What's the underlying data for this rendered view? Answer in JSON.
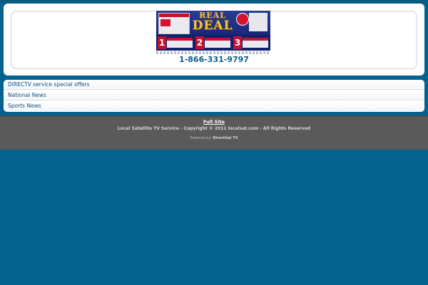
{
  "banner": {
    "headline_top": "REAL",
    "headline_main": "DEAL",
    "offer_numbers": [
      "1",
      "2",
      "3"
    ]
  },
  "header": {
    "phone": "1-866-331-9797"
  },
  "nav": {
    "items": [
      {
        "label": "DIRECTV service special offers"
      },
      {
        "label": "National News"
      },
      {
        "label": "Sports News"
      }
    ]
  },
  "footer": {
    "full_site": "Full Site",
    "copyright": "Local Satellite TV Service - Copyright © 2011 localsat.com - All Rights Reserved",
    "powered_by_label": "Powered by:",
    "powered_by_name": "DirectSat TV"
  },
  "colors": {
    "page_background": "#04628e",
    "link": "#0d4f86",
    "footer_background": "#5a5a5a"
  }
}
